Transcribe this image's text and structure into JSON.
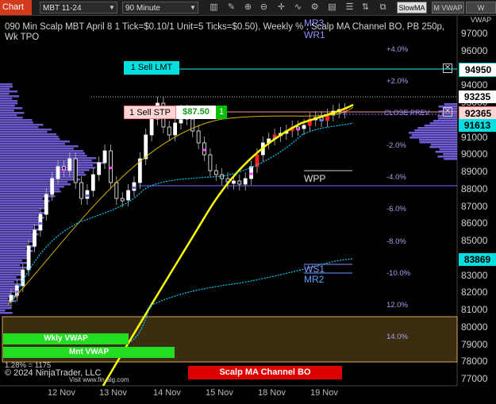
{
  "toolbar": {
    "chart_tab": "Chart",
    "instrument": "MBT 11-24",
    "interval": "90 Minute",
    "buttons": [
      "SlowMA",
      "M VWAP",
      "W VWAP"
    ],
    "icons": [
      "bar-style-icon",
      "drawing-tool-icon",
      "zoom-in-icon",
      "zoom-out-icon",
      "crosshair-icon",
      "indicator-icon",
      "strategy-icon",
      "template-icon",
      "properties-icon",
      "chart-trader-icon"
    ]
  },
  "title": "090 Min Scalp MBT April 8 1 Tick=$0.10/1 Unit=5 Ticks=$0.50), Weekly % , Scalp MA Channel BO, PB 250p, Wk TPO",
  "price_axis": [
    "97000",
    "96000",
    "95000",
    "94000",
    "93000",
    "92000",
    "91000",
    "90000",
    "89000",
    "88000",
    "87000",
    "86000",
    "85000",
    "84000",
    "83000",
    "82000",
    "81000",
    "80000",
    "79000",
    "78000",
    "77000"
  ],
  "price_tags": [
    {
      "label": "94950",
      "bg": "#ffffff",
      "fg": "#000000",
      "border": "#00c8c8"
    },
    {
      "label": "93235",
      "bg": "#ffffff",
      "fg": "#000000",
      "border": "#ffffff"
    },
    {
      "label": "92365",
      "bg": "#ffd6d6",
      "fg": "#000000",
      "border": "#ff8080"
    },
    {
      "label": "91613",
      "bg": "#00e0e0",
      "fg": "#000000",
      "border": "#00e0e0"
    },
    {
      "label": "83869",
      "bg": "#00e0e0",
      "fg": "#000000",
      "border": "#00e0e0"
    }
  ],
  "pct_levels": [
    "+4.0%",
    "+2.0%",
    "-2.0%",
    "-4.0%",
    "-6.0%",
    "-8.0%",
    "-10.0%",
    "12.0%",
    "14.0%"
  ],
  "close_label": "CLOSE PREV",
  "pivots": [
    "MR3",
    "WR1",
    "WPP",
    "WS1",
    "MR2"
  ],
  "orders": {
    "sell_limit": "1 Sell LMT",
    "sell_stop": "1 Sell STP",
    "pnl": "$87.50",
    "qty": "1"
  },
  "bands": {
    "wkly_vwap": "Wkly VWAP",
    "mnt_vwap": "Mnt VWAP",
    "channel_bo": "Scalp MA Channel BO"
  },
  "footer": {
    "ratio": "1.28% = 1175",
    "copyright": "© 2024 NinjaTrader, LLC",
    "website": "Visit www.fin-alg.com"
  },
  "dates": [
    "12 Nov",
    "13 Nov",
    "14 Nov",
    "15 Nov",
    "18 Nov",
    "19 Nov"
  ],
  "colors": {
    "up": "#ffffff",
    "down": "#ff2020",
    "vwap": "#00d0ff",
    "ma": "#ffff00",
    "profile": "#7b68ee"
  }
}
